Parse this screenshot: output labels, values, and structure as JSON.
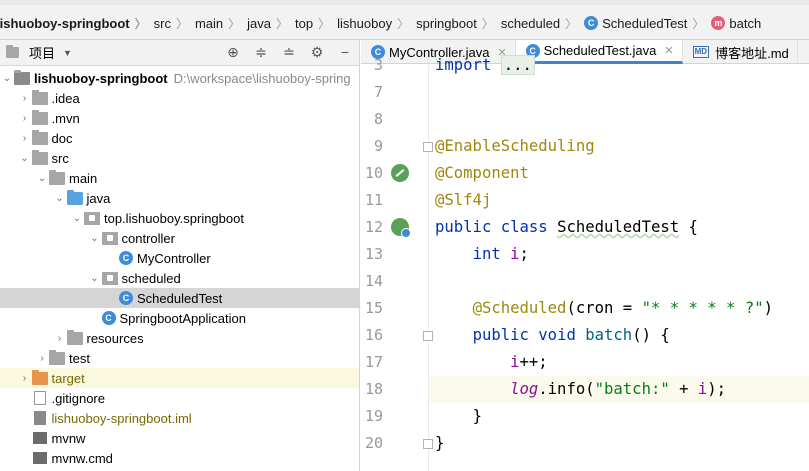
{
  "breadcrumb": {
    "items": [
      {
        "label": "lishuoboy-springboot",
        "bold": true
      },
      {
        "label": "src"
      },
      {
        "label": "main"
      },
      {
        "label": "java"
      },
      {
        "label": "top"
      },
      {
        "label": "lishuoboy"
      },
      {
        "label": "springboot"
      },
      {
        "label": "scheduled"
      },
      {
        "label": "ScheduledTest",
        "icon": "class-icon"
      },
      {
        "label": "batch",
        "icon": "method-icon"
      }
    ]
  },
  "project_panel": {
    "title": "项目",
    "tools": [
      "locate-icon",
      "expand-all-icon",
      "collapse-all-icon",
      "settings-icon",
      "hide-icon"
    ],
    "tree": [
      {
        "label": "lishuoboy-springboot",
        "path": "D:\\workspace\\lishuoboy-spring",
        "depth": 0,
        "expanded": true,
        "icon": "module-folder-icon"
      },
      {
        "label": ".idea",
        "depth": 1,
        "expanded": false,
        "icon": "folder-icon"
      },
      {
        "label": ".mvn",
        "depth": 1,
        "expanded": false,
        "icon": "folder-icon"
      },
      {
        "label": "doc",
        "depth": 1,
        "expanded": false,
        "icon": "folder-icon"
      },
      {
        "label": "src",
        "depth": 1,
        "expanded": true,
        "icon": "folder-icon"
      },
      {
        "label": "main",
        "depth": 2,
        "expanded": true,
        "icon": "folder-icon"
      },
      {
        "label": "java",
        "depth": 3,
        "expanded": true,
        "icon": "source-folder-icon"
      },
      {
        "label": "top.lishuoboy.springboot",
        "depth": 4,
        "expanded": true,
        "icon": "package-icon"
      },
      {
        "label": "controller",
        "depth": 5,
        "expanded": true,
        "icon": "package-icon"
      },
      {
        "label": "MyController",
        "depth": 6,
        "icon": "class-icon"
      },
      {
        "label": "scheduled",
        "depth": 5,
        "expanded": true,
        "icon": "package-icon"
      },
      {
        "label": "ScheduledTest",
        "depth": 6,
        "icon": "class-icon",
        "selected": true
      },
      {
        "label": "SpringbootApplication",
        "depth": 5,
        "icon": "spring-class-icon"
      },
      {
        "label": "resources",
        "depth": 3,
        "expanded": false,
        "icon": "resources-folder-icon"
      },
      {
        "label": "test",
        "depth": 2,
        "expanded": false,
        "icon": "folder-icon"
      },
      {
        "label": "target",
        "depth": 1,
        "expanded": false,
        "icon": "excluded-folder-icon",
        "highlighted": true
      },
      {
        "label": ".gitignore",
        "depth": 1,
        "icon": "file-icon"
      },
      {
        "label": "lishuoboy-springboot.iml",
        "depth": 1,
        "icon": "iml-icon"
      },
      {
        "label": "mvnw",
        "depth": 1,
        "icon": "shell-icon"
      },
      {
        "label": "mvnw.cmd",
        "depth": 1,
        "icon": "cmd-icon"
      }
    ]
  },
  "editor": {
    "tabs": [
      {
        "label": "MyController.java",
        "icon": "class-icon",
        "active": false
      },
      {
        "label": "ScheduledTest.java",
        "icon": "class-icon",
        "active": true
      },
      {
        "label": "博客地址.md",
        "icon": "markdown-icon",
        "active": false
      }
    ],
    "line_numbers": [
      "3",
      "7",
      "8",
      "9",
      "10",
      "11",
      "12",
      "13",
      "14",
      "15",
      "16",
      "17",
      "18",
      "19",
      "20"
    ],
    "code": {
      "import_kw": "import",
      "import_collapsed": "...",
      "enable_scheduling": "@EnableScheduling",
      "component": "@Component",
      "slf4j": "@Slf4j",
      "public": "public",
      "class": "class",
      "class_name": "ScheduledTest",
      "open_brace": " {",
      "int": "int",
      "field_i": "i",
      "semicolon": ";",
      "scheduled_ann": "@Scheduled",
      "cron_open": "(cron = ",
      "cron_value": "\"* * * * * ?\"",
      "cron_close": ")",
      "void": "void",
      "method_name": "batch",
      "method_sig_end": "() {",
      "inc_i": "i",
      "inc_op": "++;",
      "log": "log",
      "info_call": ".info(",
      "log_str": "\"batch:\"",
      "plus": " + ",
      "log_i": "i",
      "log_end": ");",
      "close_inner": "}",
      "close_outer": "}"
    }
  }
}
